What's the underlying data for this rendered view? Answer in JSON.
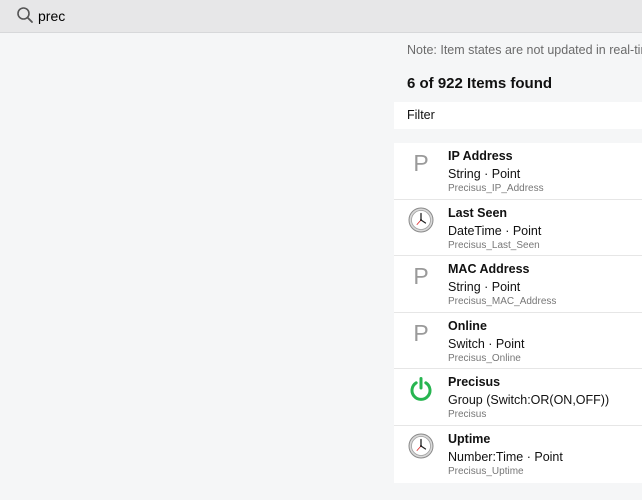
{
  "search": {
    "value": "prec",
    "icon": "search-icon"
  },
  "note": "Note: Item states are not updated in real-time",
  "results": {
    "title": "6 of 922 Items found",
    "filter_label": "Filter"
  },
  "items": [
    {
      "label": "IP Address",
      "type": "String · Point",
      "name": "Precisus_IP_Address",
      "icon": "p-icon"
    },
    {
      "label": "Last Seen",
      "type": "DateTime · Point",
      "name": "Precisus_Last_Seen",
      "icon": "clock-icon"
    },
    {
      "label": "MAC Address",
      "type": "String · Point",
      "name": "Precisus_MAC_Address",
      "icon": "p-icon"
    },
    {
      "label": "Online",
      "type": "Switch · Point",
      "name": "Precisus_Online",
      "icon": "p-icon"
    },
    {
      "label": "Precisus",
      "type": "Group (Switch:OR(ON,OFF))",
      "name": "Precisus",
      "icon": "power-icon"
    },
    {
      "label": "Uptime",
      "type": "Number:Time · Point",
      "name": "Precisus_Uptime",
      "icon": "clock-icon"
    }
  ],
  "colors": {
    "power_green": "#27b550",
    "p_icon_gray": "#9a9a9a"
  }
}
